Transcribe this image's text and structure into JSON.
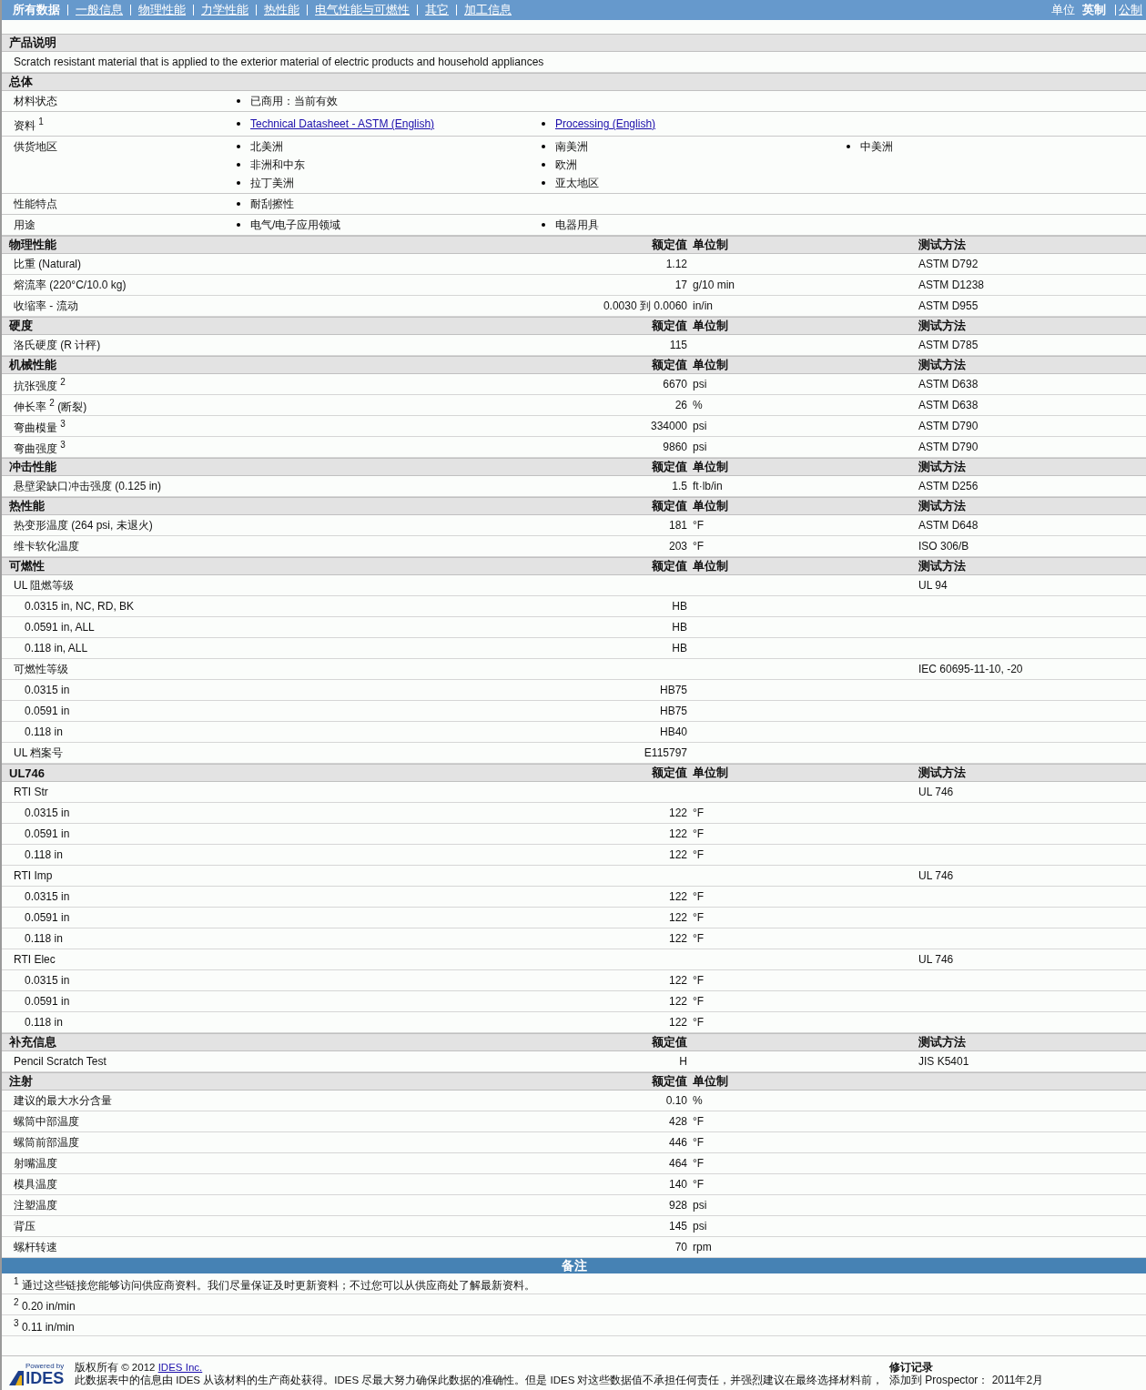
{
  "nav": {
    "tabs": [
      {
        "label": "所有数据",
        "selected": true
      },
      {
        "label": "一般信息",
        "selected": false
      },
      {
        "label": "物理性能",
        "selected": false
      },
      {
        "label": "力学性能",
        "selected": false
      },
      {
        "label": "热性能",
        "selected": false
      },
      {
        "label": "电气性能与可燃性",
        "selected": false
      },
      {
        "label": "其它",
        "selected": false
      },
      {
        "label": "加工信息",
        "selected": false
      }
    ],
    "units_label": "单位",
    "units": [
      {
        "label": "英制",
        "selected": true
      },
      {
        "label": "公制",
        "selected": false
      }
    ]
  },
  "sections": [
    {
      "kind": "text",
      "title": "产品说明",
      "text": "Scratch resistant material that is applied to the exterior material of electric products and household appliances"
    },
    {
      "kind": "general",
      "title": "总体",
      "rows": [
        {
          "label": "材料状态",
          "items": [
            {
              "text": "已商用：当前有效",
              "link": false
            }
          ]
        },
        {
          "label": "资料 $^{1}$",
          "items": [
            {
              "text": "Technical Datasheet - ASTM (English)",
              "link": true
            },
            {
              "text": "Processing (English)",
              "link": true
            }
          ]
        },
        {
          "label": "供货地区",
          "items": [
            {
              "text": "北美洲",
              "link": false
            },
            {
              "text": "非洲和中东",
              "link": false
            },
            {
              "text": "拉丁美洲",
              "link": false
            },
            {
              "text": "南美洲",
              "link": false
            },
            {
              "text": "欧洲",
              "link": false
            },
            {
              "text": "亚太地区",
              "link": false
            },
            {
              "text": "中美洲",
              "link": false
            }
          ]
        },
        {
          "label": "性能特点",
          "items": [
            {
              "text": "耐刮擦性",
              "link": false
            }
          ]
        },
        {
          "label": "用途",
          "items": [
            {
              "text": "电气/电子应用领域",
              "link": false
            },
            {
              "text": "电器用具",
              "link": false
            }
          ]
        }
      ]
    },
    {
      "kind": "props",
      "title": "物理性能",
      "value_header": "额定值",
      "unit_header": "单位制",
      "method_header": "测试方法",
      "rows": [
        {
          "label": "比重  (Natural)",
          "value": "1.12",
          "method": "ASTM D792"
        },
        {
          "label": "熔流率  (220°C/10.0 kg)",
          "value": "17",
          "unit": "g/10 min",
          "method": "ASTM D1238"
        },
        {
          "label": "收缩率  - 流动",
          "value": "0.0030 到  0.0060",
          "unit": "in/in",
          "method": "ASTM D955"
        }
      ]
    },
    {
      "kind": "props",
      "title": "硬度",
      "value_header": "额定值",
      "unit_header": "单位制",
      "method_header": "测试方法",
      "rows": [
        {
          "label": "洛氏硬度  (R 计秤)",
          "value": "115",
          "method": "ASTM D785"
        }
      ]
    },
    {
      "kind": "props",
      "title": "机械性能",
      "value_header": "额定值",
      "unit_header": "单位制",
      "method_header": "测试方法",
      "rows": [
        {
          "label": "抗张强度 $^{2}$",
          "value": "6670",
          "unit": "psi",
          "method": "ASTM D638"
        },
        {
          "label": "伸长率 $^{2}$ (断裂)",
          "value": "26",
          "unit": "%",
          "method": "ASTM D638"
        },
        {
          "label": "弯曲模量 $^{3}$",
          "value": "334000",
          "unit": "psi",
          "method": "ASTM D790"
        },
        {
          "label": "弯曲强度 $^{3}$",
          "value": "9860",
          "unit": "psi",
          "method": "ASTM D790"
        }
      ]
    },
    {
      "kind": "props",
      "title": "冲击性能",
      "value_header": "额定值",
      "unit_header": "单位制",
      "method_header": "测试方法",
      "rows": [
        {
          "label": "悬壁梁缺口冲击强度  (0.125 in)",
          "value": "1.5",
          "unit": "ft·lb/in",
          "method": "ASTM D256"
        }
      ]
    },
    {
      "kind": "props",
      "title": "热性能",
      "value_header": "额定值",
      "unit_header": "单位制",
      "method_header": "测试方法",
      "rows": [
        {
          "label": "热变形温度  (264 psi, 未退火)",
          "value": "181",
          "unit": "°F",
          "method": "ASTM D648"
        },
        {
          "label": "维卡软化温度",
          "value": "203",
          "unit": "°F",
          "method": "ISO 306/B"
        }
      ]
    },
    {
      "kind": "props",
      "title": "可燃性",
      "value_header": "额定值",
      "unit_header": "单位制",
      "method_header": "测试方法",
      "rows": [
        {
          "label": "UL 阻燃等级",
          "method": "UL 94",
          "children": [
            {
              "label": "0.0315 in, NC, RD, BK",
              "value": "HB"
            },
            {
              "label": "0.0591 in, ALL",
              "value": "HB"
            },
            {
              "label": "0.118 in, ALL",
              "value": "HB"
            }
          ]
        },
        {
          "label": "可燃性等级",
          "method": "IEC 60695-11-10, -20",
          "children": [
            {
              "label": "0.0315 in",
              "value": "HB75"
            },
            {
              "label": "0.0591 in",
              "value": "HB75"
            },
            {
              "label": "0.118 in",
              "value": "HB40"
            }
          ]
        },
        {
          "label": "UL 档案号",
          "value": "E115797"
        }
      ]
    },
    {
      "kind": "props",
      "title": "UL746",
      "value_header": "额定值",
      "unit_header": "单位制",
      "method_header": "测试方法",
      "rows": [
        {
          "label": "RTI Str",
          "method": "UL 746",
          "children": [
            {
              "label": "0.0315 in",
              "value": "122",
              "unit": "°F"
            },
            {
              "label": "0.0591 in",
              "value": "122",
              "unit": "°F"
            },
            {
              "label": "0.118 in",
              "value": "122",
              "unit": "°F"
            }
          ]
        },
        {
          "label": "RTI Imp",
          "method": "UL 746",
          "children": [
            {
              "label": "0.0315 in",
              "value": "122",
              "unit": "°F"
            },
            {
              "label": "0.0591 in",
              "value": "122",
              "unit": "°F"
            },
            {
              "label": "0.118 in",
              "value": "122",
              "unit": "°F"
            }
          ]
        },
        {
          "label": "RTI Elec",
          "method": "UL 746",
          "children": [
            {
              "label": "0.0315 in",
              "value": "122",
              "unit": "°F"
            },
            {
              "label": "0.0591 in",
              "value": "122",
              "unit": "°F"
            },
            {
              "label": "0.118 in",
              "value": "122",
              "unit": "°F"
            }
          ]
        }
      ]
    },
    {
      "kind": "props",
      "title": "补充信息",
      "value_header": "额定值",
      "method_header": "测试方法",
      "rows": [
        {
          "label": "Pencil Scratch Test",
          "value": "H",
          "method": "JIS K5401"
        }
      ]
    },
    {
      "kind": "props",
      "title": "注射",
      "value_header": "额定值",
      "unit_header": "单位制",
      "rows": [
        {
          "label": "建议的最大水分含量",
          "value": "0.10",
          "unit": "%"
        },
        {
          "label": "螺筒中部温度",
          "value": "428",
          "unit": "°F"
        },
        {
          "label": "螺筒前部温度",
          "value": "446",
          "unit": "°F"
        },
        {
          "label": "射嘴温度",
          "value": "464",
          "unit": "°F"
        },
        {
          "label": "模具温度",
          "value": "140",
          "unit": "°F"
        },
        {
          "label": "注塑温度",
          "value": "928",
          "unit": "psi"
        },
        {
          "label": "背压",
          "value": "145",
          "unit": "psi"
        },
        {
          "label": "螺杆转速",
          "value": "70",
          "unit": "rpm"
        }
      ]
    }
  ],
  "notes": {
    "title": "备注",
    "items": [
      "$^{1}$ 通过这些链接您能够访问供应商资料。我们尽量保证及时更新资料；不过您可以从供应商处了解最新资料。",
      "$^{2}$ 0.20 in/min",
      "$^{3}$ 0.11 in/min"
    ]
  },
  "footer": {
    "powered_by": "Powered by",
    "logo": "IDES",
    "copyright": "版权所有  © 2012",
    "company_link": "IDES Inc.",
    "disclaimer": "此数据表中的信息由  IDES 从该材料的生产商处获得。IDES 尽最大努力确保此数据的准确性。但是  IDES 对这些数据值不承担任何责任，并强烈建议在最终选择材料前，",
    "revision_title": "修订记录",
    "revision_text": "添加到  Prospector：  2011年2月"
  }
}
